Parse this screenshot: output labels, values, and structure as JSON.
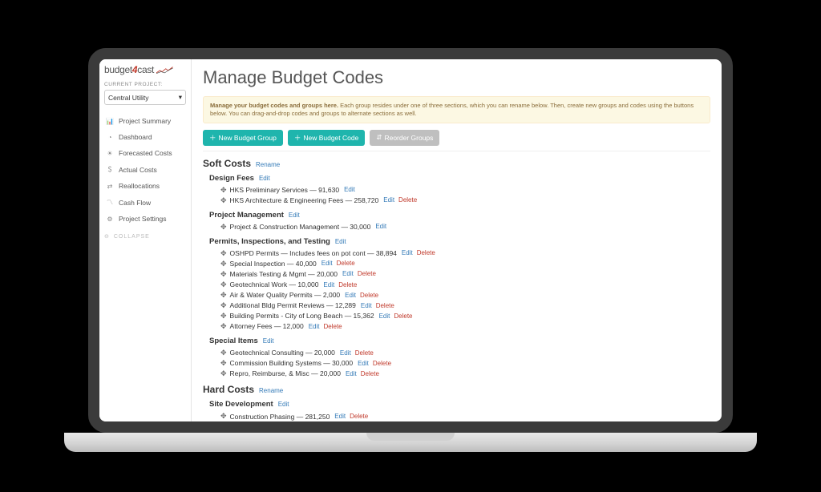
{
  "brand": {
    "pre": "budget",
    "four": "4",
    "post": "cast"
  },
  "sidebar": {
    "cp_label": "CURRENT PROJECT:",
    "project_selected": "Central Utility",
    "nav": [
      {
        "label": "Project Summary"
      },
      {
        "label": "Dashboard"
      },
      {
        "label": "Forecasted Costs"
      },
      {
        "label": "Actual Costs"
      },
      {
        "label": "Reallocations"
      },
      {
        "label": "Cash Flow"
      },
      {
        "label": "Project Settings"
      }
    ],
    "collapse": "COLLAPSE"
  },
  "page": {
    "title": "Manage Budget Codes",
    "banner_bold": "Manage your budget codes and groups here.",
    "banner_rest": " Each group resides under one of three sections, which you can rename below. Then, create new groups and codes using the buttons below. You can drag-and-drop codes and groups to alternate sections as well.",
    "btn_new_group": "New Budget Group",
    "btn_new_code": "New Budget Code",
    "btn_reorder": "Reorder Groups",
    "rename": "Rename",
    "edit": "Edit",
    "delete": "Delete"
  },
  "sections": [
    {
      "title": "Soft Costs",
      "groups": [
        {
          "title": "Design Fees",
          "codes": [
            {
              "text": "HKS Preliminary Services — 91,630",
              "del": false
            },
            {
              "text": "HKS Architecture & Engineering Fees — 258,720",
              "del": true
            }
          ]
        },
        {
          "title": "Project Management",
          "codes": [
            {
              "text": "Project & Construction Management — 30,000",
              "del": false
            }
          ]
        },
        {
          "title": "Permits, Inspections, and Testing",
          "codes": [
            {
              "text": "OSHPD Permits — Includes fees on pot cont — 38,894",
              "del": true
            },
            {
              "text": "Special Inspection — 40,000",
              "del": true
            },
            {
              "text": "Materials Testing & Mgmt — 20,000",
              "del": true
            },
            {
              "text": "Geotechnical Work — 10,000",
              "del": true
            },
            {
              "text": "Air & Water Quality Permits — 2,000",
              "del": true
            },
            {
              "text": "Additional Bldg Permit Reviews — 12,289",
              "del": true
            },
            {
              "text": "Building Permits - City of Long Beach — 15,362",
              "del": true
            },
            {
              "text": "Attorney Fees — 12,000",
              "del": true
            }
          ]
        },
        {
          "title": "Special Items",
          "codes": [
            {
              "text": "Geotechnical Consulting — 20,000",
              "del": true
            },
            {
              "text": "Commission Building Systems — 30,000",
              "del": true
            },
            {
              "text": "Repro, Reimburse, & Misc — 20,000",
              "del": true
            }
          ]
        }
      ]
    },
    {
      "title": "Hard Costs",
      "groups": [
        {
          "title": "Site Development",
          "codes": [
            {
              "text": "Construction Phasing — 281,250",
              "del": true
            }
          ]
        }
      ]
    }
  ]
}
